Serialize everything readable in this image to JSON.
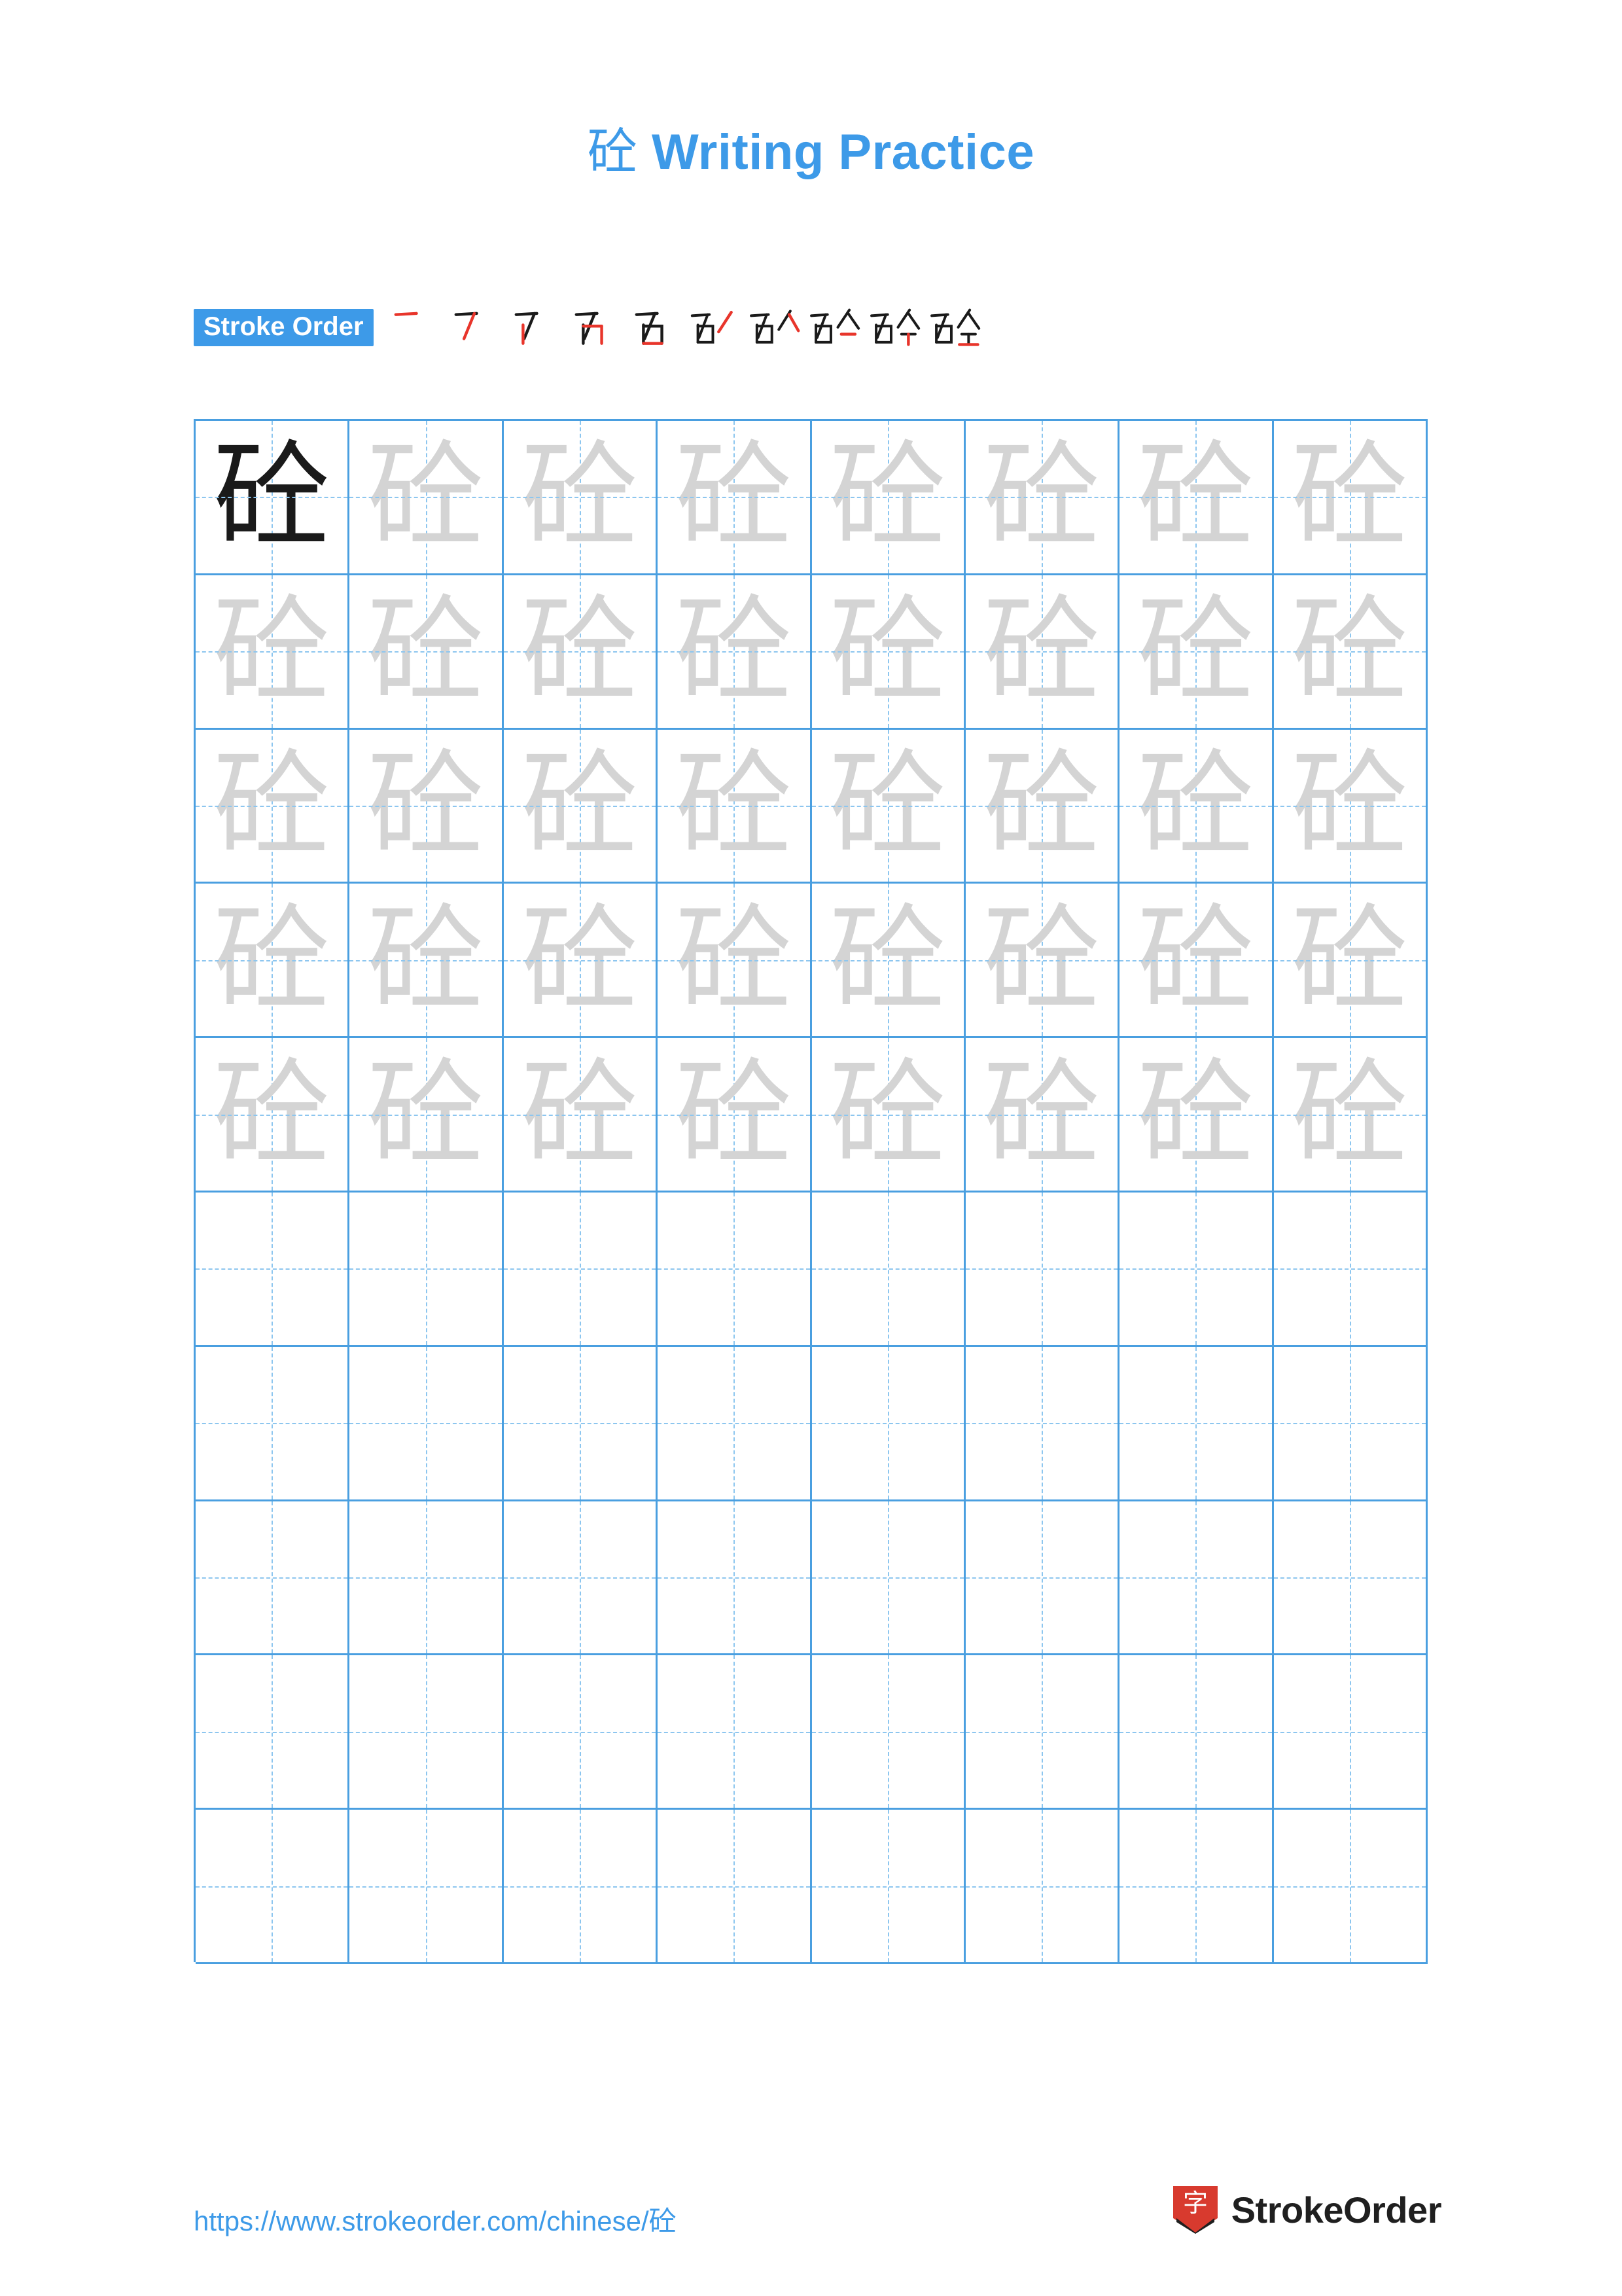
{
  "document": {
    "character": "砼",
    "title_suffix": " Writing Practice"
  },
  "stroke_order": {
    "label": "Stroke Order",
    "count": 10,
    "steps": [
      {
        "index": 1,
        "partial": "一"
      },
      {
        "index": 2,
        "partial": "𠂉"
      },
      {
        "index": 3,
        "partial": "丆"
      },
      {
        "index": 4,
        "partial": "石"
      },
      {
        "index": 5,
        "partial": "石"
      },
      {
        "index": 6,
        "partial": "石丿"
      },
      {
        "index": 7,
        "partial": "石人"
      },
      {
        "index": 8,
        "partial": "砼"
      },
      {
        "index": 9,
        "partial": "砼"
      },
      {
        "index": 10,
        "partial": "砼"
      }
    ]
  },
  "grid": {
    "columns": 8,
    "rows": 10,
    "rows_data": [
      [
        "dark",
        "ghost",
        "ghost",
        "ghost",
        "ghost",
        "ghost",
        "ghost",
        "ghost"
      ],
      [
        "ghost",
        "ghost",
        "ghost",
        "ghost",
        "ghost",
        "ghost",
        "ghost",
        "ghost"
      ],
      [
        "ghost",
        "ghost",
        "ghost",
        "ghost",
        "ghost",
        "ghost",
        "ghost",
        "ghost"
      ],
      [
        "ghost",
        "ghost",
        "ghost",
        "ghost",
        "ghost",
        "ghost",
        "ghost",
        "ghost"
      ],
      [
        "ghost",
        "ghost",
        "ghost",
        "ghost",
        "ghost",
        "ghost",
        "ghost",
        "ghost"
      ],
      [
        "empty",
        "empty",
        "empty",
        "empty",
        "empty",
        "empty",
        "empty",
        "empty"
      ],
      [
        "empty",
        "empty",
        "empty",
        "empty",
        "empty",
        "empty",
        "empty",
        "empty"
      ],
      [
        "empty",
        "empty",
        "empty",
        "empty",
        "empty",
        "empty",
        "empty",
        "empty"
      ],
      [
        "empty",
        "empty",
        "empty",
        "empty",
        "empty",
        "empty",
        "empty",
        "empty"
      ],
      [
        "empty",
        "empty",
        "empty",
        "empty",
        "empty",
        "empty",
        "empty",
        "empty"
      ]
    ]
  },
  "footer": {
    "url_prefix": "https://www.strokeorder.com/chinese/",
    "url_character": "砼",
    "brand_name": "StrokeOrder",
    "brand_logo_glyph": "字"
  },
  "colors": {
    "accent": "#3d9ae8",
    "grid_line": "#4a9fe0",
    "grid_dash": "#8dc6ef",
    "ghost_glyph": "#d4d4d4",
    "dark_glyph": "#1a1a1a",
    "new_stroke": "#e8352b",
    "old_stroke": "#1a1a1a",
    "logo_red": "#d83a2e"
  }
}
